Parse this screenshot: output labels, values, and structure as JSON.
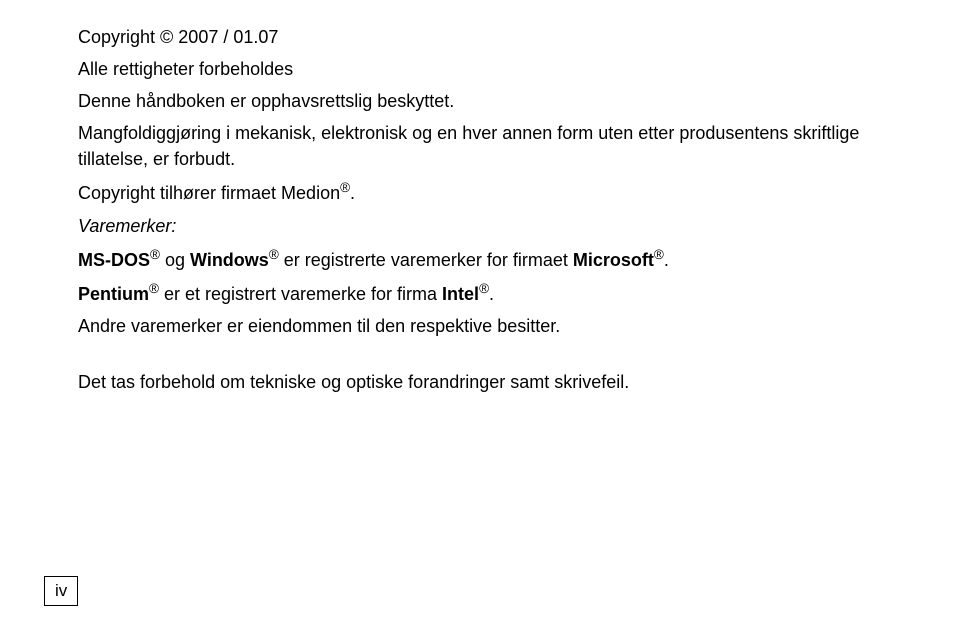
{
  "copyright_line": "Copyright © 2007 / 01.07",
  "rights_line": "Alle rettigheter forbeholdes",
  "handbook_line": "Denne håndboken er opphavsrettslig beskyttet.",
  "mangfold_line": "Mangfoldiggjøring i mekanisk, elektronisk og en hver annen form uten etter produsentens skriftlige tillatelse, er forbudt.",
  "copyright_firm_prefix": "Copyright tilhører firmaet Medion",
  "copyright_firm_suffix": ".",
  "varemerker_label": "Varemerker:",
  "msdos": "MS-DOS",
  "and_word": " og ",
  "windows": "Windows",
  "reg_mid": " er registrerte varemerker for firmaet ",
  "microsoft": "Microsoft",
  "period": ".",
  "pentium": "Pentium",
  "pentium_mid": " er et registrert varemerke for firma ",
  "intel": "Intel",
  "andre_line": "Andre varemerker er eiendommen til den respektive besitter.",
  "forbehold_line": "Det tas forbehold om tekniske og optiske forandringer samt skrivefeil.",
  "reg_symbol": "®",
  "page_number": "iv"
}
